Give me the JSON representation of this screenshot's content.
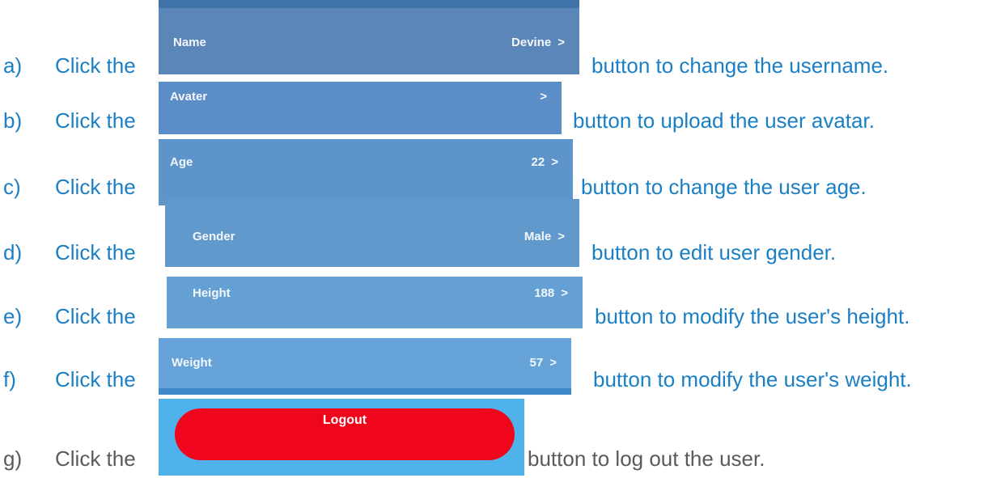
{
  "items": [
    {
      "marker": "a)",
      "click": "Click the",
      "label": "Name",
      "value": "Devine",
      "chevron": ">",
      "after": "button to change the username."
    },
    {
      "marker": "b)",
      "click": "Click the",
      "label": "Avater",
      "value": "",
      "chevron": ">",
      "after": "button to upload the user avatar."
    },
    {
      "marker": "c)",
      "click": "Click the",
      "label": "Age",
      "value": "22",
      "chevron": ">",
      "after": "button to change the user age."
    },
    {
      "marker": "d)",
      "click": "Click the",
      "label": "Gender",
      "value": "Male",
      "chevron": ">",
      "after": "button to edit user gender."
    },
    {
      "marker": "e)",
      "click": "Click the",
      "label": "Height",
      "value": "188",
      "chevron": ">",
      "after": "button to modify the user's height."
    },
    {
      "marker": "f)",
      "click": "Click the",
      "label": "Weight",
      "value": "57",
      "chevron": ">",
      "after": "button to modify the user's weight."
    },
    {
      "marker": "g)",
      "click": "Click the",
      "label": "Logout",
      "after": "button to log out the user."
    }
  ],
  "colors": {
    "instruction_text": "#1b7fc4",
    "last_instruction_text": "#5a5a5a",
    "logout_button": "#f0061c",
    "logout_background": "#4fb2ea"
  }
}
